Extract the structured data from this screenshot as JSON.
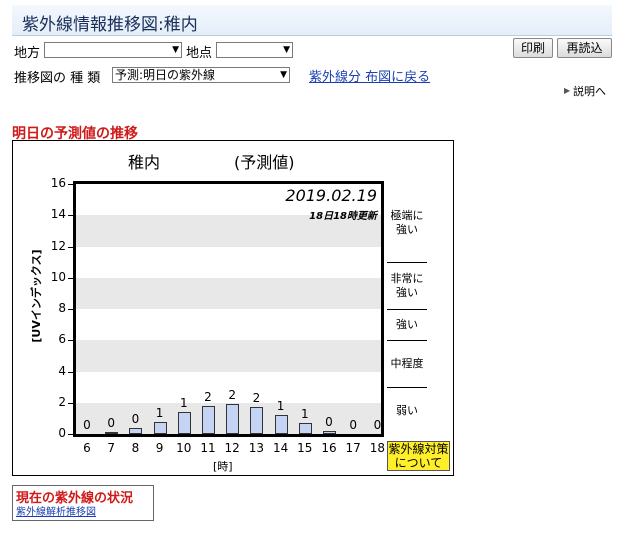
{
  "header": {
    "title": "紫外線情報推移図:稚内"
  },
  "controls": {
    "region_label": "地方",
    "region_value": "",
    "point_label": "地点",
    "point_value": "",
    "print_button": "印刷",
    "reload_button": "再読込",
    "type_label": "推移図の 種 類",
    "type_value": "予測:明日の紫外線",
    "back_link": "紫外線分 布図に戻る",
    "explain_link": "説明へ"
  },
  "section": {
    "title": "明日の予測値の推移"
  },
  "chart_data": {
    "type": "bar",
    "title": "稚内",
    "subtitle": "(予測値)",
    "date": "2019.02.19",
    "updated": "18日18時更新",
    "ylabel": "[UVインデックス]",
    "xlabel": "[時]",
    "ylim": [
      0,
      16
    ],
    "yticks": [
      "16",
      "14",
      "12",
      "10",
      "8",
      "6",
      "4",
      "2",
      "0"
    ],
    "categories": [
      "6",
      "7",
      "8",
      "9",
      "10",
      "11",
      "12",
      "13",
      "14",
      "15",
      "16",
      "17",
      "18"
    ],
    "values": [
      0,
      0.1,
      0.4,
      0.8,
      1.4,
      1.8,
      1.9,
      1.7,
      1.2,
      0.7,
      0.2,
      0,
      0
    ],
    "labels": [
      "0",
      "0",
      "0",
      "1",
      "1",
      "2",
      "2",
      "2",
      "1",
      "1",
      "0",
      "0",
      "0"
    ],
    "levels": [
      "極端に強い",
      "非常に強い",
      "強い",
      "中程度",
      "弱い"
    ]
  },
  "uv_button": "紫外線対策について",
  "status": {
    "title": "現在の紫外線の状況",
    "link": "紫外線解析推移図"
  }
}
